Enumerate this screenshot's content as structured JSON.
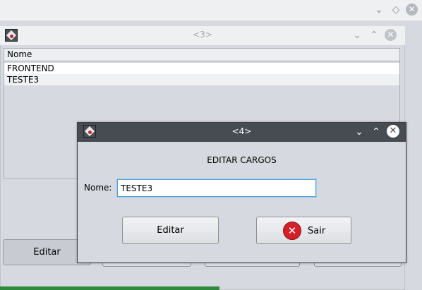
{
  "outer_window": {
    "controls": [
      "chevron-down-icon",
      "diamond-icon",
      "close-icon"
    ]
  },
  "frame3": {
    "title": "<3>",
    "table": {
      "columns": [
        "Nome"
      ],
      "rows": [
        "FRONTEND",
        "TESTE3"
      ]
    },
    "buttons": {
      "editar": "Editar"
    }
  },
  "dialog": {
    "title": "<4>",
    "heading": "EDITAR CARGOS",
    "nome_label": "Nome:",
    "nome_value": "TESTE3",
    "buttons": {
      "editar": "Editar",
      "sair": "Sair"
    },
    "title_bg": "#474c53",
    "sair_icon_color": "#d32029"
  },
  "progress": {
    "fraction": 0.52,
    "color": "#2e8b3d"
  }
}
